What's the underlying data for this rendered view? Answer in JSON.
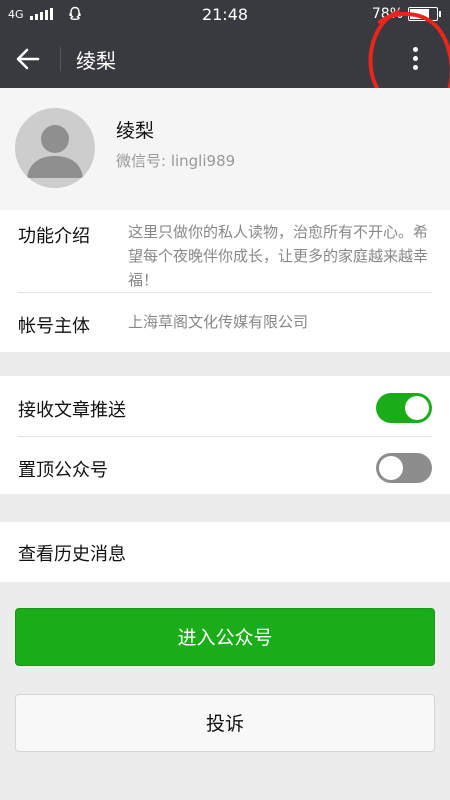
{
  "status_bar": {
    "network": "4G",
    "time": "21:48",
    "battery_percent": "78%",
    "battery_level": 0.78
  },
  "header": {
    "title": "绫梨"
  },
  "profile": {
    "name": "绫梨",
    "wechat_id": "微信号: lingli989"
  },
  "info": {
    "intro_label": "功能介绍",
    "intro_value": "这里只做你的私人读物，治愈所有不开心。希望每个夜晚伴你成长，让更多的家庭越来越幸福！",
    "owner_label": "帐号主体",
    "owner_value": "上海草阁文化传媒有限公司"
  },
  "settings": {
    "receive_label": "接收文章推送",
    "receive_on": true,
    "pin_label": "置顶公众号",
    "pin_on": false
  },
  "history": {
    "label": "查看历史消息"
  },
  "actions": {
    "enter_label": "进入公众号",
    "report_label": "投诉"
  },
  "colors": {
    "titlebar": "#393a3f",
    "accent_green": "#1aad19",
    "annotation_red": "#e8261c"
  }
}
